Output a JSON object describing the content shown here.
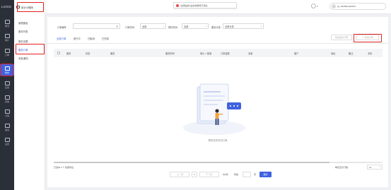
{
  "logo": "LOGO",
  "nav": [
    {
      "label": "概况"
    },
    {
      "label": "客户"
    },
    {
      "label": "订单"
    },
    {
      "label": "财务"
    },
    {
      "label": "应用"
    },
    {
      "label": "营销"
    },
    {
      "label": "分销"
    },
    {
      "label": "渠道"
    },
    {
      "label": "设置"
    }
  ],
  "shop_name": "设计小程序",
  "subnav": [
    "管理面板",
    "服务列表",
    "服务设置",
    "服务订单",
    "消息通知"
  ],
  "notice": "[这里是的] 由系统审核不通过",
  "account": "gh_8949f51da0515",
  "filters": {
    "order_no_label": "订单编号",
    "order_no_placeholder": "",
    "type_label": "订单时间:",
    "type_value": "全部",
    "status_label": "预约时间:",
    "status_value": "全部",
    "service_label": "服务分类:",
    "service_value": "全部分类"
  },
  "tabs": [
    "全部订单",
    "进行中",
    "已取消",
    "已完成"
  ],
  "export_selected": "导出选中订单",
  "export_label": "导出订单",
  "columns": [
    "服务",
    "状态",
    "服务",
    "服务时间",
    "单价 × 数量",
    "订单金额",
    "流量",
    "客户",
    "地址",
    "备注",
    "手机"
  ],
  "empty_text": "暂时没有任何订单",
  "footer": {
    "left": "已选中 0 个   批量导出",
    "page_size_label": "每页显示行数:",
    "page_size": "10",
    "prev": "上一页",
    "page": "1",
    "next": "下一页",
    "total": "共0页",
    "goto": "到第",
    "page_unit": "页",
    "confirm": "确定"
  },
  "colors": {
    "accent": "#3f62e0",
    "highlight": "#e02020",
    "nav_bg": "#2b2f38"
  }
}
